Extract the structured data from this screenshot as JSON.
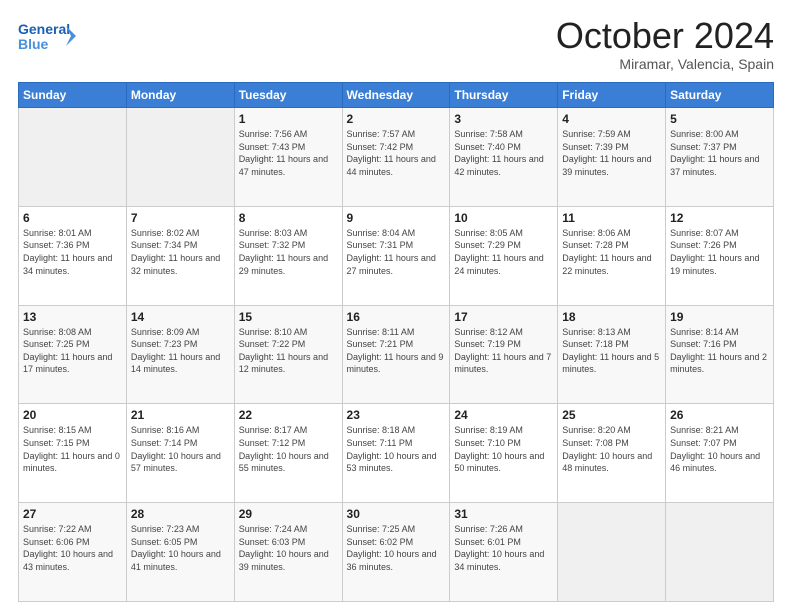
{
  "header": {
    "logo_general": "General",
    "logo_blue": "Blue",
    "month": "October 2024",
    "location": "Miramar, Valencia, Spain"
  },
  "days_of_week": [
    "Sunday",
    "Monday",
    "Tuesday",
    "Wednesday",
    "Thursday",
    "Friday",
    "Saturday"
  ],
  "weeks": [
    [
      {
        "day": "",
        "sunrise": "",
        "sunset": "",
        "daylight": ""
      },
      {
        "day": "",
        "sunrise": "",
        "sunset": "",
        "daylight": ""
      },
      {
        "day": "1",
        "sunrise": "Sunrise: 7:56 AM",
        "sunset": "Sunset: 7:43 PM",
        "daylight": "Daylight: 11 hours and 47 minutes."
      },
      {
        "day": "2",
        "sunrise": "Sunrise: 7:57 AM",
        "sunset": "Sunset: 7:42 PM",
        "daylight": "Daylight: 11 hours and 44 minutes."
      },
      {
        "day": "3",
        "sunrise": "Sunrise: 7:58 AM",
        "sunset": "Sunset: 7:40 PM",
        "daylight": "Daylight: 11 hours and 42 minutes."
      },
      {
        "day": "4",
        "sunrise": "Sunrise: 7:59 AM",
        "sunset": "Sunset: 7:39 PM",
        "daylight": "Daylight: 11 hours and 39 minutes."
      },
      {
        "day": "5",
        "sunrise": "Sunrise: 8:00 AM",
        "sunset": "Sunset: 7:37 PM",
        "daylight": "Daylight: 11 hours and 37 minutes."
      }
    ],
    [
      {
        "day": "6",
        "sunrise": "Sunrise: 8:01 AM",
        "sunset": "Sunset: 7:36 PM",
        "daylight": "Daylight: 11 hours and 34 minutes."
      },
      {
        "day": "7",
        "sunrise": "Sunrise: 8:02 AM",
        "sunset": "Sunset: 7:34 PM",
        "daylight": "Daylight: 11 hours and 32 minutes."
      },
      {
        "day": "8",
        "sunrise": "Sunrise: 8:03 AM",
        "sunset": "Sunset: 7:32 PM",
        "daylight": "Daylight: 11 hours and 29 minutes."
      },
      {
        "day": "9",
        "sunrise": "Sunrise: 8:04 AM",
        "sunset": "Sunset: 7:31 PM",
        "daylight": "Daylight: 11 hours and 27 minutes."
      },
      {
        "day": "10",
        "sunrise": "Sunrise: 8:05 AM",
        "sunset": "Sunset: 7:29 PM",
        "daylight": "Daylight: 11 hours and 24 minutes."
      },
      {
        "day": "11",
        "sunrise": "Sunrise: 8:06 AM",
        "sunset": "Sunset: 7:28 PM",
        "daylight": "Daylight: 11 hours and 22 minutes."
      },
      {
        "day": "12",
        "sunrise": "Sunrise: 8:07 AM",
        "sunset": "Sunset: 7:26 PM",
        "daylight": "Daylight: 11 hours and 19 minutes."
      }
    ],
    [
      {
        "day": "13",
        "sunrise": "Sunrise: 8:08 AM",
        "sunset": "Sunset: 7:25 PM",
        "daylight": "Daylight: 11 hours and 17 minutes."
      },
      {
        "day": "14",
        "sunrise": "Sunrise: 8:09 AM",
        "sunset": "Sunset: 7:23 PM",
        "daylight": "Daylight: 11 hours and 14 minutes."
      },
      {
        "day": "15",
        "sunrise": "Sunrise: 8:10 AM",
        "sunset": "Sunset: 7:22 PM",
        "daylight": "Daylight: 11 hours and 12 minutes."
      },
      {
        "day": "16",
        "sunrise": "Sunrise: 8:11 AM",
        "sunset": "Sunset: 7:21 PM",
        "daylight": "Daylight: 11 hours and 9 minutes."
      },
      {
        "day": "17",
        "sunrise": "Sunrise: 8:12 AM",
        "sunset": "Sunset: 7:19 PM",
        "daylight": "Daylight: 11 hours and 7 minutes."
      },
      {
        "day": "18",
        "sunrise": "Sunrise: 8:13 AM",
        "sunset": "Sunset: 7:18 PM",
        "daylight": "Daylight: 11 hours and 5 minutes."
      },
      {
        "day": "19",
        "sunrise": "Sunrise: 8:14 AM",
        "sunset": "Sunset: 7:16 PM",
        "daylight": "Daylight: 11 hours and 2 minutes."
      }
    ],
    [
      {
        "day": "20",
        "sunrise": "Sunrise: 8:15 AM",
        "sunset": "Sunset: 7:15 PM",
        "daylight": "Daylight: 11 hours and 0 minutes."
      },
      {
        "day": "21",
        "sunrise": "Sunrise: 8:16 AM",
        "sunset": "Sunset: 7:14 PM",
        "daylight": "Daylight: 10 hours and 57 minutes."
      },
      {
        "day": "22",
        "sunrise": "Sunrise: 8:17 AM",
        "sunset": "Sunset: 7:12 PM",
        "daylight": "Daylight: 10 hours and 55 minutes."
      },
      {
        "day": "23",
        "sunrise": "Sunrise: 8:18 AM",
        "sunset": "Sunset: 7:11 PM",
        "daylight": "Daylight: 10 hours and 53 minutes."
      },
      {
        "day": "24",
        "sunrise": "Sunrise: 8:19 AM",
        "sunset": "Sunset: 7:10 PM",
        "daylight": "Daylight: 10 hours and 50 minutes."
      },
      {
        "day": "25",
        "sunrise": "Sunrise: 8:20 AM",
        "sunset": "Sunset: 7:08 PM",
        "daylight": "Daylight: 10 hours and 48 minutes."
      },
      {
        "day": "26",
        "sunrise": "Sunrise: 8:21 AM",
        "sunset": "Sunset: 7:07 PM",
        "daylight": "Daylight: 10 hours and 46 minutes."
      }
    ],
    [
      {
        "day": "27",
        "sunrise": "Sunrise: 7:22 AM",
        "sunset": "Sunset: 6:06 PM",
        "daylight": "Daylight: 10 hours and 43 minutes."
      },
      {
        "day": "28",
        "sunrise": "Sunrise: 7:23 AM",
        "sunset": "Sunset: 6:05 PM",
        "daylight": "Daylight: 10 hours and 41 minutes."
      },
      {
        "day": "29",
        "sunrise": "Sunrise: 7:24 AM",
        "sunset": "Sunset: 6:03 PM",
        "daylight": "Daylight: 10 hours and 39 minutes."
      },
      {
        "day": "30",
        "sunrise": "Sunrise: 7:25 AM",
        "sunset": "Sunset: 6:02 PM",
        "daylight": "Daylight: 10 hours and 36 minutes."
      },
      {
        "day": "31",
        "sunrise": "Sunrise: 7:26 AM",
        "sunset": "Sunset: 6:01 PM",
        "daylight": "Daylight: 10 hours and 34 minutes."
      },
      {
        "day": "",
        "sunrise": "",
        "sunset": "",
        "daylight": ""
      },
      {
        "day": "",
        "sunrise": "",
        "sunset": "",
        "daylight": ""
      }
    ]
  ]
}
